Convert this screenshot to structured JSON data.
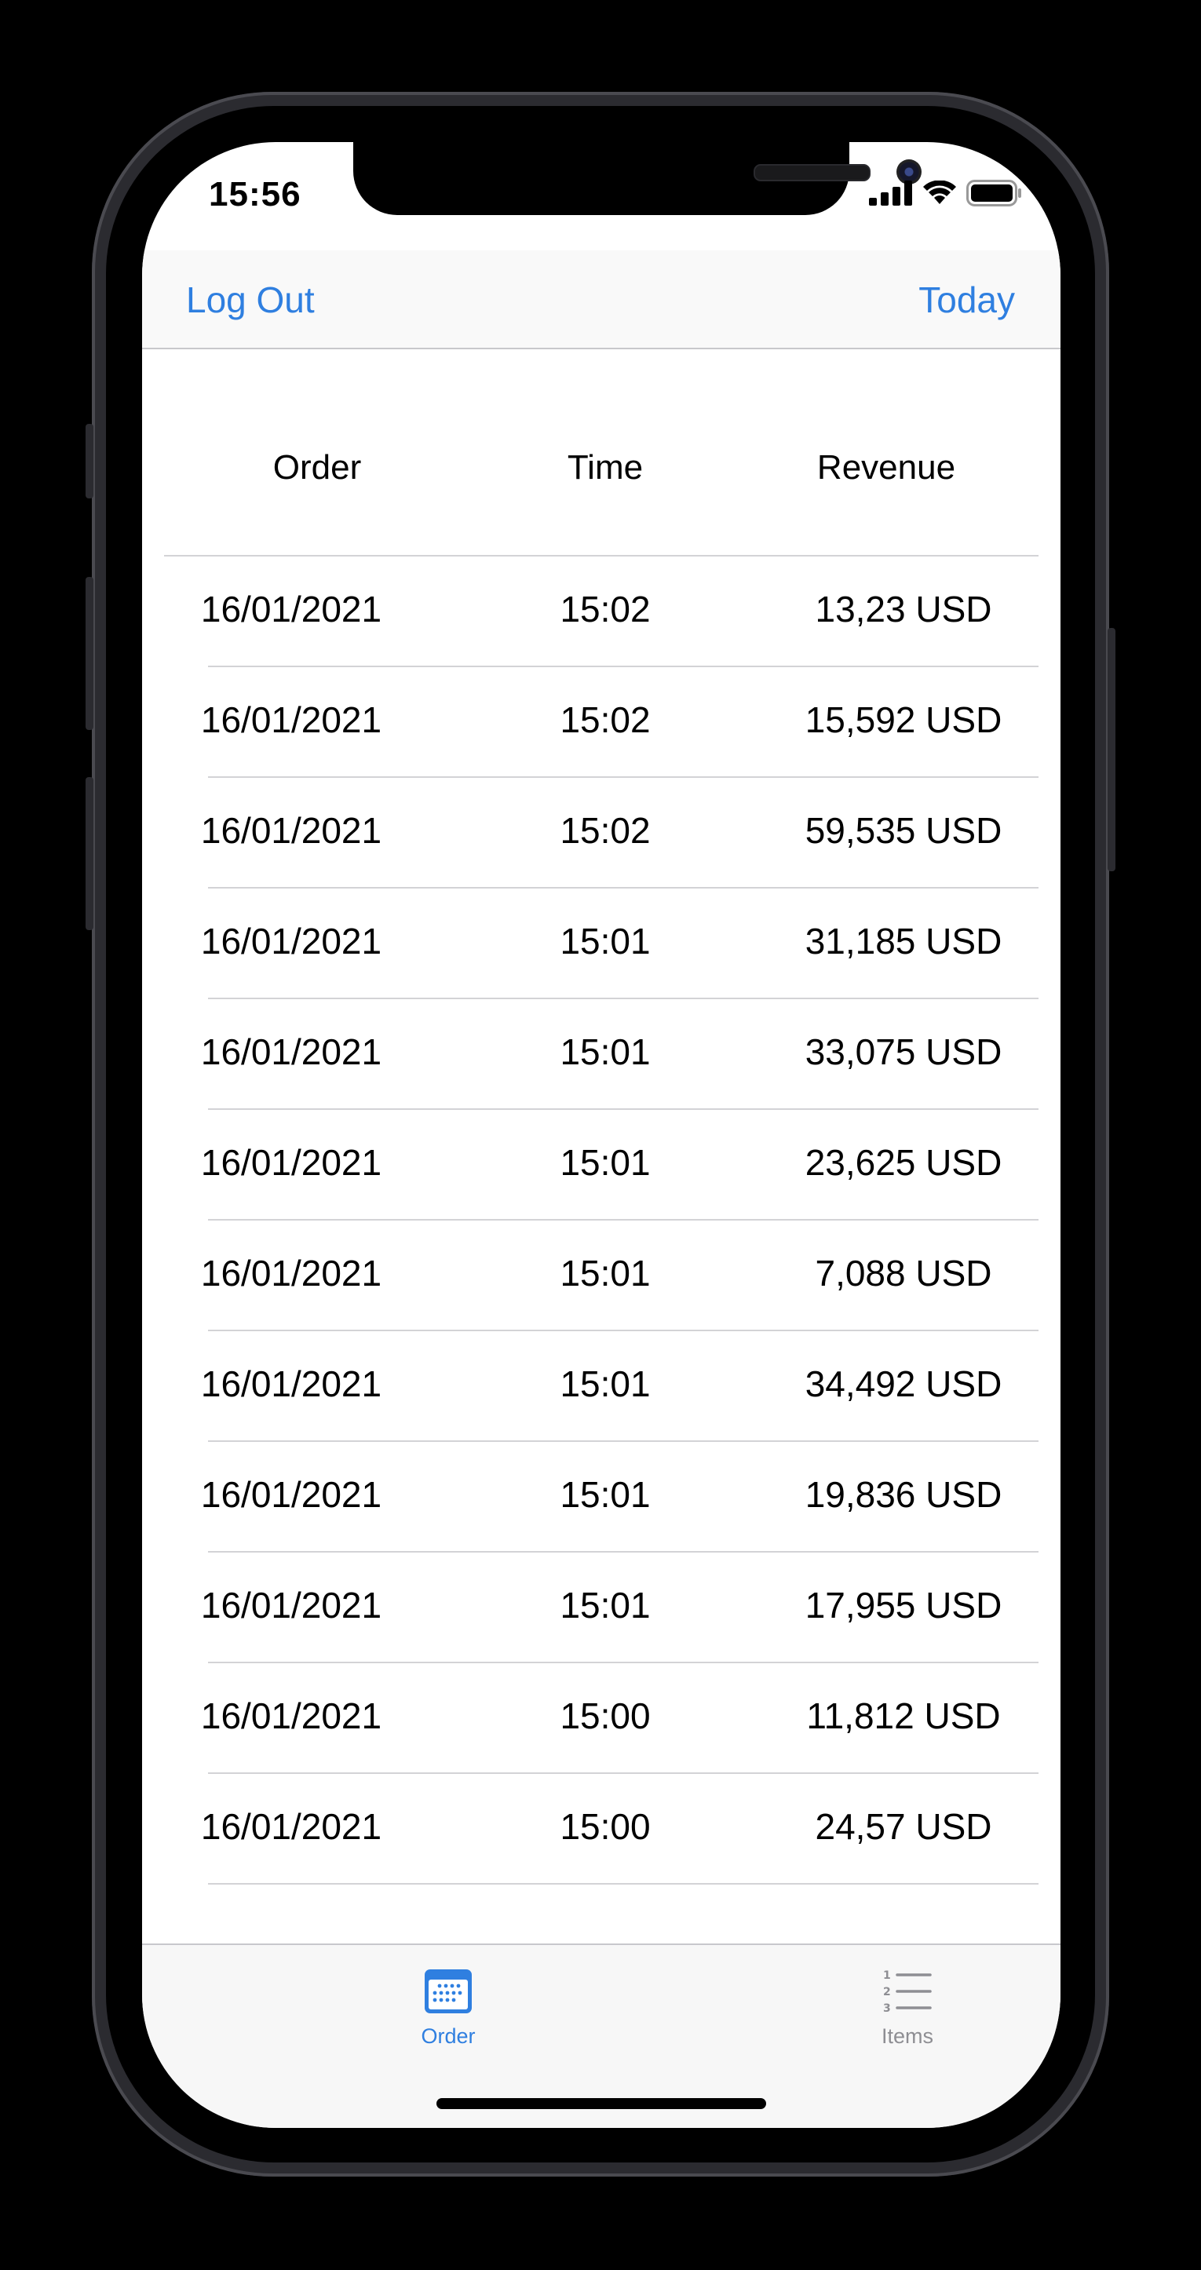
{
  "status_bar": {
    "time": "15:56"
  },
  "nav": {
    "left_button": "Log Out",
    "right_button": "Today"
  },
  "table": {
    "headers": [
      "Order",
      "Time",
      "Revenue"
    ],
    "rows": [
      {
        "date": "16/01/2021",
        "time": "15:02",
        "revenue": "13,23 USD"
      },
      {
        "date": "16/01/2021",
        "time": "15:02",
        "revenue": "15,592 USD"
      },
      {
        "date": "16/01/2021",
        "time": "15:02",
        "revenue": "59,535 USD"
      },
      {
        "date": "16/01/2021",
        "time": "15:01",
        "revenue": "31,185 USD"
      },
      {
        "date": "16/01/2021",
        "time": "15:01",
        "revenue": "33,075 USD"
      },
      {
        "date": "16/01/2021",
        "time": "15:01",
        "revenue": "23,625 USD"
      },
      {
        "date": "16/01/2021",
        "time": "15:01",
        "revenue": "7,088 USD"
      },
      {
        "date": "16/01/2021",
        "time": "15:01",
        "revenue": "34,492 USD"
      },
      {
        "date": "16/01/2021",
        "time": "15:01",
        "revenue": "19,836 USD"
      },
      {
        "date": "16/01/2021",
        "time": "15:01",
        "revenue": "17,955 USD"
      },
      {
        "date": "16/01/2021",
        "time": "15:00",
        "revenue": "11,812 USD"
      },
      {
        "date": "16/01/2021",
        "time": "15:00",
        "revenue": "24,57 USD"
      }
    ]
  },
  "tab_bar": {
    "tabs": [
      {
        "label": "Order",
        "icon": "calendar-icon",
        "selected": true
      },
      {
        "label": "Items",
        "icon": "numbered-list-icon",
        "selected": false
      }
    ]
  },
  "colors": {
    "accent": "#2f7fe0",
    "inactive": "#8e8e93",
    "separator": "#d3d3d6"
  }
}
